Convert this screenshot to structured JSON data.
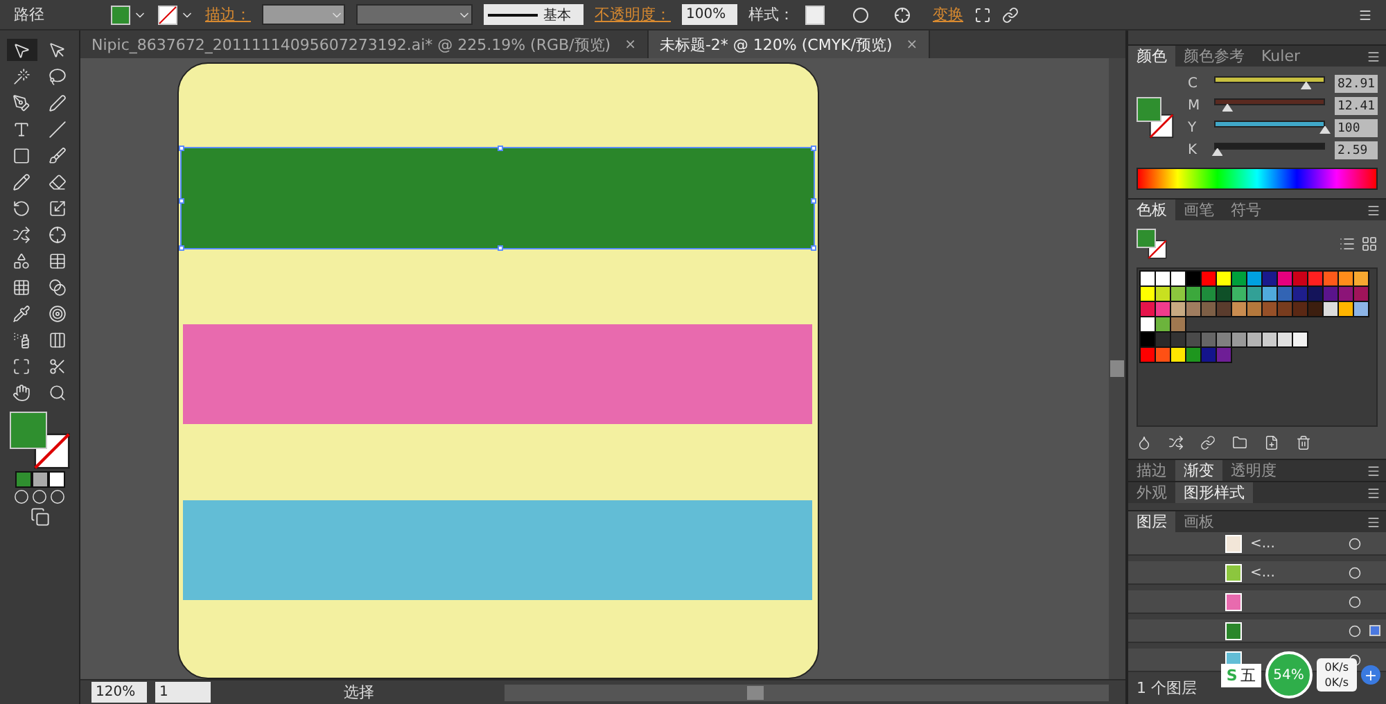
{
  "control_bar": {
    "label": "路径",
    "fill": {
      "color": "#2f8f2f"
    },
    "stroke_label": "描边：",
    "stroke_style": "基本",
    "opacity_label": "不透明度：",
    "opacity_value": "100%",
    "style_label": "样式：",
    "transform_link": "变换"
  },
  "document_tabs": [
    {
      "title": "Nipic_8637672_20111114095607273192.ai* @ 225.19% (RGB/预览)",
      "close": "×",
      "selected": false
    },
    {
      "title": "未标题-2* @ 120% (CMYK/预览)",
      "close": "×",
      "selected": true
    }
  ],
  "artboard": {
    "stripes": [
      {
        "color": "#2a862a",
        "selected": true
      },
      {
        "color": "#e86aae",
        "selected": false
      },
      {
        "color": "#62bdd6",
        "selected": false
      }
    ]
  },
  "tools": {
    "fill": {
      "color": "#2f8f2f"
    }
  },
  "color_panel": {
    "tabs": [
      {
        "label": "颜色",
        "selected": true
      },
      {
        "label": "颜色参考",
        "selected": false
      },
      {
        "label": "Kuler",
        "selected": false
      }
    ],
    "sliders": [
      {
        "name": "C",
        "level": 0.83,
        "value": "82.91",
        "color": "#c8c040"
      },
      {
        "name": "M",
        "level": 0.12,
        "value": "12.41",
        "color": "#5a2a20"
      },
      {
        "name": "Y",
        "level": 1,
        "value": "100",
        "color": "#40a8c8"
      },
      {
        "name": "K",
        "level": 0.03,
        "value": "2.59",
        "color": "#202020"
      }
    ]
  },
  "swatches_panel": {
    "tabs": [
      {
        "label": "色板",
        "selected": true
      },
      {
        "label": "画笔",
        "selected": false
      },
      {
        "label": "符号",
        "selected": false
      }
    ],
    "rows": [
      [
        {
          "color": "#ffffff"
        },
        {
          "color": "#ffffff"
        },
        {
          "color": "#ffffff"
        },
        {
          "color": "#000000"
        },
        {
          "color": "#ff0000"
        },
        {
          "color": "#ffff00"
        },
        {
          "color": "#00a03c"
        },
        {
          "color": "#00a0e0"
        },
        {
          "color": "#1a1a8c"
        },
        {
          "color": "#e6007e"
        },
        {
          "color": "#cc0018"
        },
        {
          "color": "#ff2020"
        },
        {
          "color": "#ff5a1a"
        },
        {
          "color": "#ff8c1a"
        },
        {
          "color": "#f7a830"
        }
      ],
      [
        {
          "color": "#ffff00"
        },
        {
          "color": "#c8e020"
        },
        {
          "color": "#8cc63e"
        },
        {
          "color": "#3ca83c"
        },
        {
          "color": "#1e8c3c"
        },
        {
          "color": "#0f5028"
        },
        {
          "color": "#3cb464"
        },
        {
          "color": "#32a096"
        },
        {
          "color": "#50aadc"
        },
        {
          "color": "#3264b4"
        },
        {
          "color": "#1e1e8c"
        },
        {
          "color": "#14145a"
        },
        {
          "color": "#5a148c"
        },
        {
          "color": "#8c1478"
        },
        {
          "color": "#a0145a"
        }
      ],
      [
        {
          "color": "#e6144b"
        },
        {
          "color": "#f03c8c"
        },
        {
          "color": "#c8aa82"
        },
        {
          "color": "#a07d5f"
        },
        {
          "color": "#7d5f46"
        },
        {
          "color": "#5a3c2d"
        },
        {
          "color": "#c88c50"
        },
        {
          "color": "#b4783c"
        },
        {
          "color": "#965028"
        },
        {
          "color": "#783c1e"
        },
        {
          "color": "#5a2814"
        },
        {
          "color": "#3c1e0f"
        },
        {
          "color": "#dcdcdc"
        },
        {
          "color": "#ffb400"
        },
        {
          "color": "#8cb4e6"
        }
      ],
      [
        {
          "color": "#ffffff"
        },
        {
          "color": "#6cb43c"
        },
        {
          "color": "#a07850"
        }
      ],
      [
        {
          "color": "#000000"
        },
        {
          "color": "#2a2a2a"
        },
        {
          "color": "#333333"
        },
        {
          "color": "#4a4a4a"
        },
        {
          "color": "#666666"
        },
        {
          "color": "#808080"
        },
        {
          "color": "#999999"
        },
        {
          "color": "#b3b3b3"
        },
        {
          "color": "#cccccc"
        },
        {
          "color": "#e0e0e0"
        },
        {
          "color": "#f2f2f2"
        }
      ],
      [
        {
          "color": "#ff0000"
        },
        {
          "color": "#ff5014"
        },
        {
          "color": "#ffe600"
        },
        {
          "color": "#1e961e"
        },
        {
          "color": "#14148c"
        },
        {
          "color": "#6e1e96"
        }
      ]
    ]
  },
  "stroke_tabs": [
    {
      "label": "描边",
      "selected": false
    },
    {
      "label": "渐变",
      "selected": true
    },
    {
      "label": "透明度",
      "selected": false
    }
  ],
  "appearance_tabs": [
    {
      "label": "外观",
      "selected": false
    },
    {
      "label": "图形样式",
      "selected": true
    }
  ],
  "layers_panel": {
    "tabs": [
      {
        "label": "图层",
        "selected": true
      },
      {
        "label": "画板",
        "selected": false
      }
    ],
    "rows": [
      {
        "name": "<...",
        "thumb": {
          "color": "#f2e6d8"
        },
        "selected": false
      },
      {
        "name": "<...",
        "thumb": {
          "color": "#8cc63e"
        },
        "selected": false
      },
      {
        "thumb": {
          "color": "#e86aae"
        },
        "selected": false
      },
      {
        "thumb": {
          "color": "#2a862a"
        },
        "selected": true
      },
      {
        "thumb": {
          "color": "#62bdd6"
        },
        "selected": false
      }
    ],
    "count": "1 个图层"
  },
  "status_bar": {
    "zoom": "120%",
    "artboard": "1",
    "tool": "选择"
  },
  "net_widget": {
    "ime_logo": "S",
    "ime": "五",
    "percent": "54%",
    "upload": "0K/s",
    "download": "0K/s",
    "add": "+"
  }
}
